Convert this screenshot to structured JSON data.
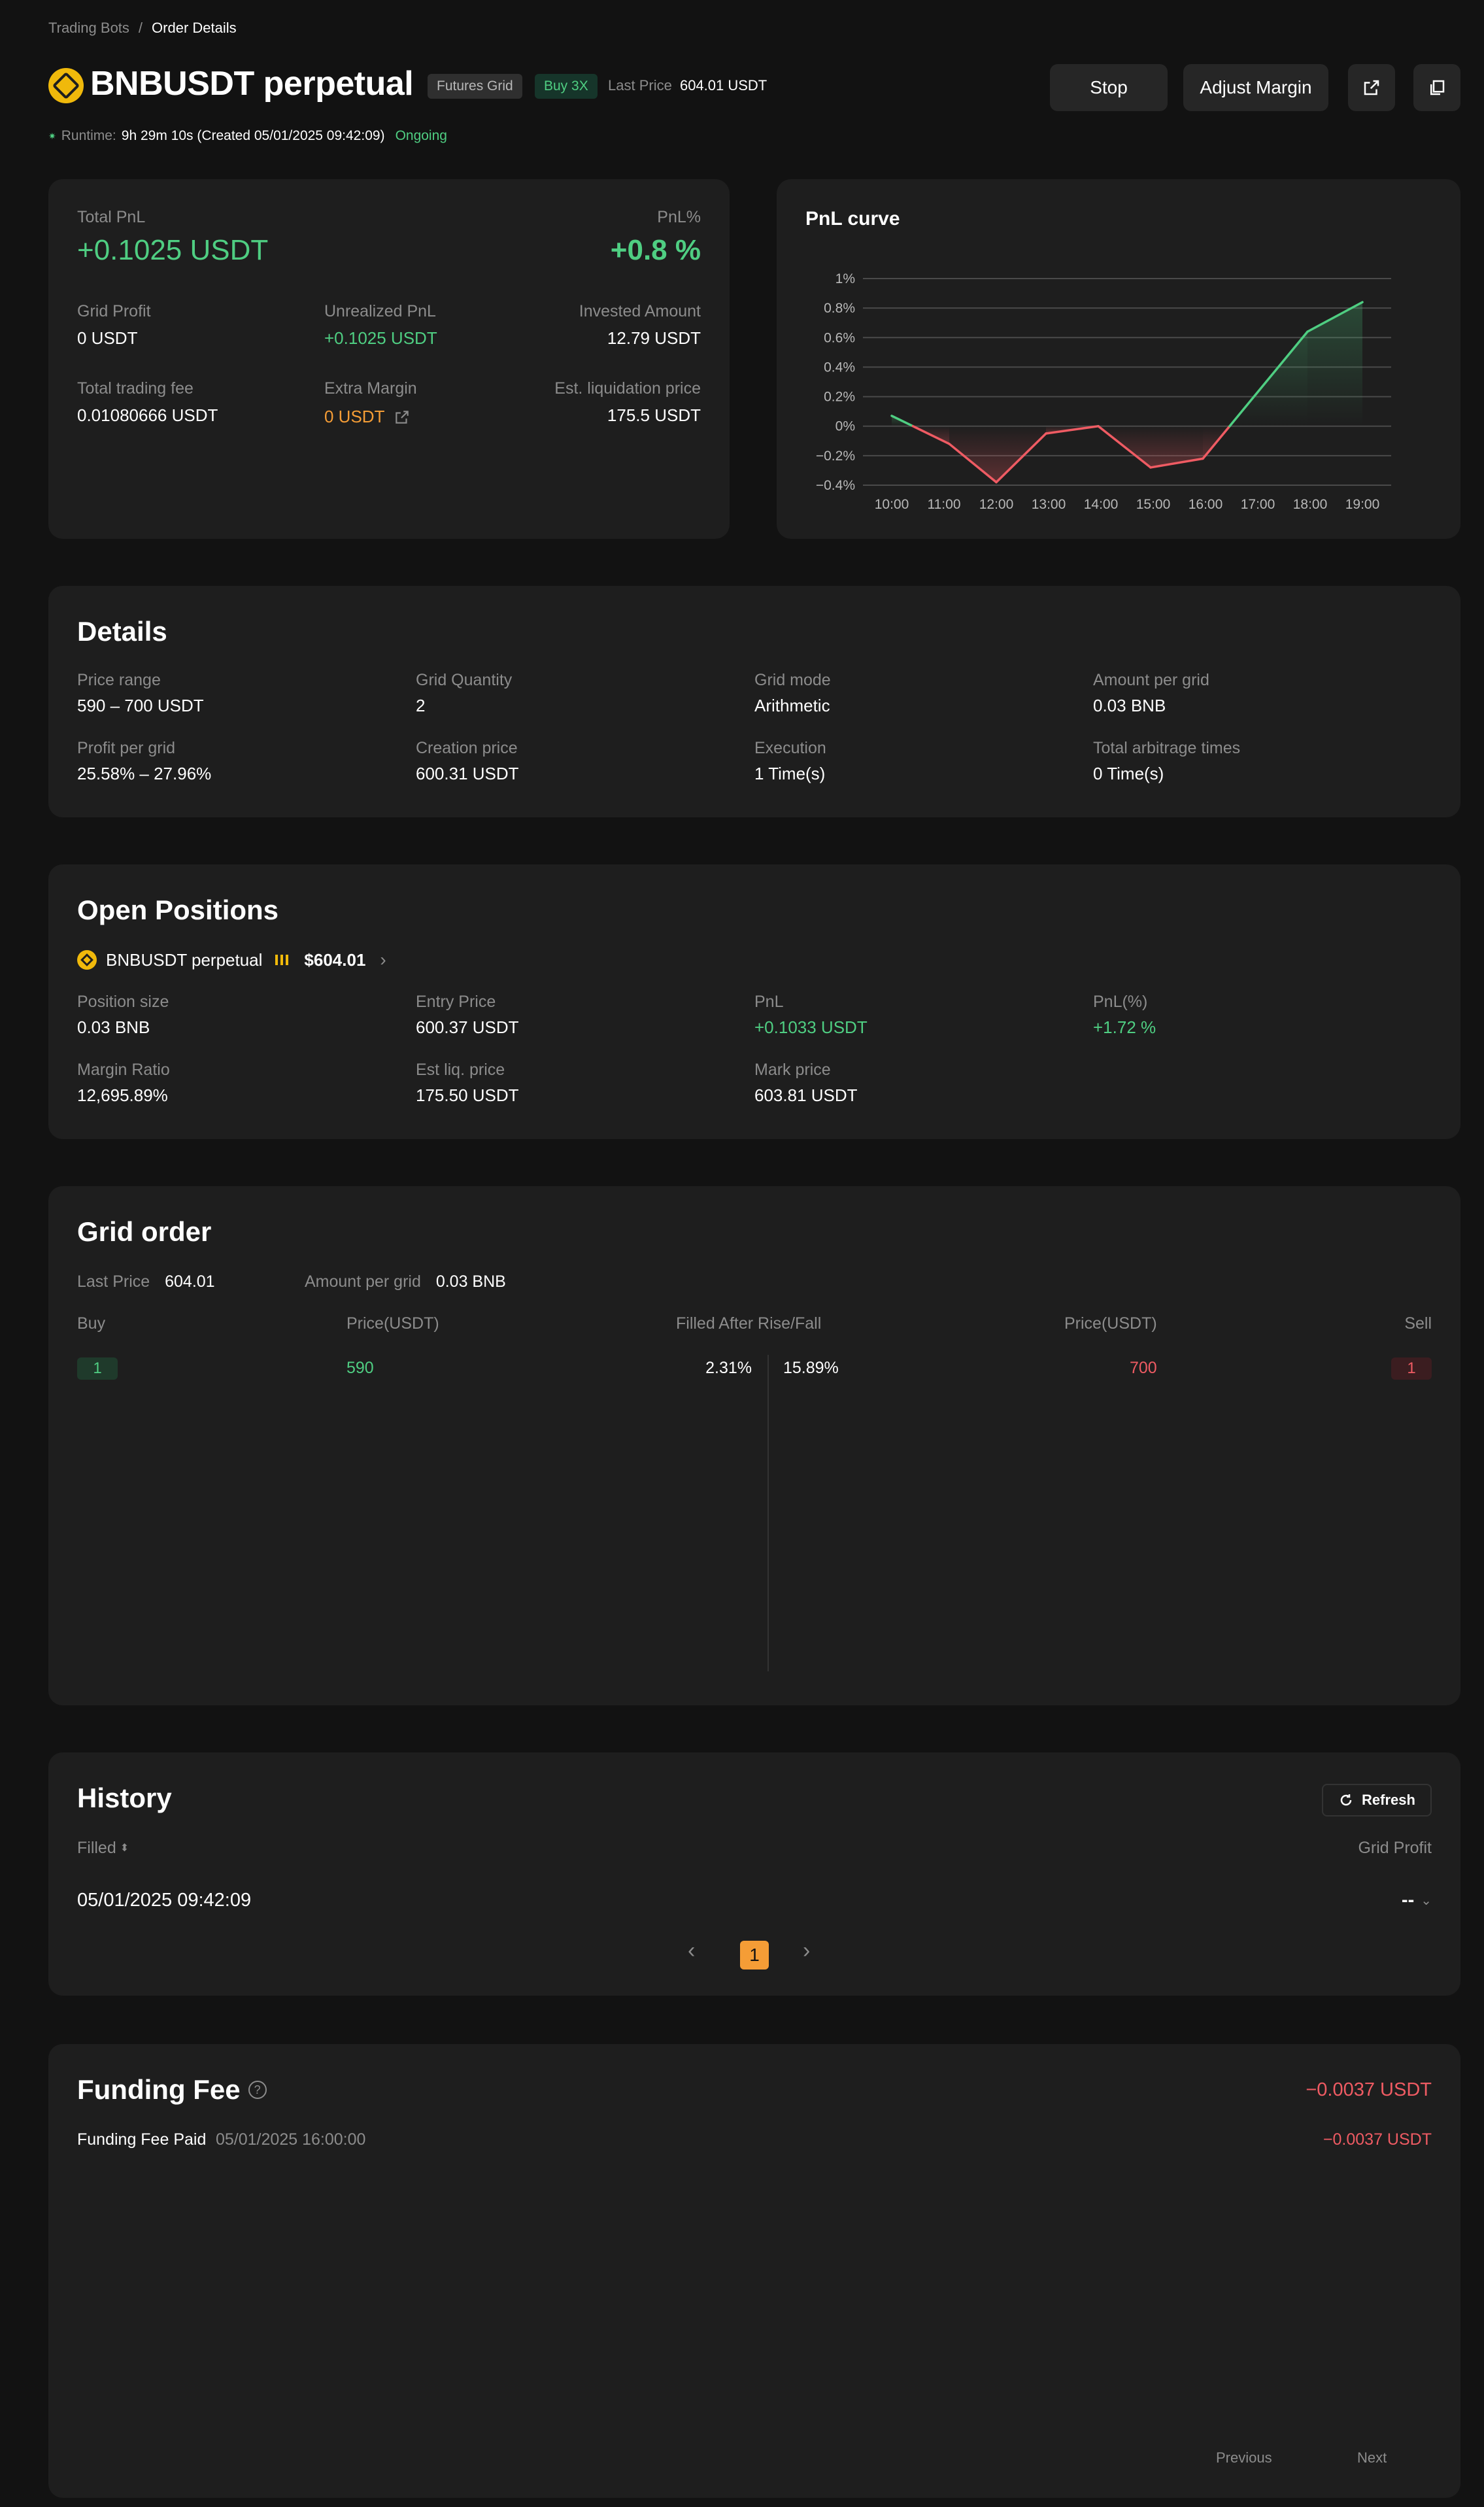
{
  "breadcrumb": {
    "root": "Trading Bots",
    "separator": "/",
    "current": "Order Details"
  },
  "header": {
    "title": "BNBUSDT perpetual",
    "tag_type": "Futures Grid",
    "tag_direction": "Buy 3X",
    "last_price_label": "Last Price",
    "last_price_value": "604.01 USDT",
    "stop_label": "Stop",
    "adjust_margin_label": "Adjust Margin",
    "runtime_label": "Runtime:",
    "runtime_value": "9h 29m 10s (Created 05/01/2025 09:42:09)",
    "status": "Ongoing"
  },
  "summary": {
    "total_pnl_label": "Total PnL",
    "total_pnl_value": "+0.1025 USDT",
    "pnl_pct_label": "PnL%",
    "pnl_pct_value": "+0.8 %",
    "grid_profit_label": "Grid Profit",
    "grid_profit_value": "0 USDT",
    "unrealized_label": "Unrealized PnL",
    "unrealized_value": "+0.1025 USDT",
    "invested_label": "Invested Amount",
    "invested_value": "12.79 USDT",
    "fee_label": "Total trading fee",
    "fee_value": "0.01080666 USDT",
    "extra_margin_label": "Extra Margin",
    "extra_margin_value": "0 USDT",
    "liq_label": "Est. liquidation price",
    "liq_value": "175.5 USDT"
  },
  "chart_data": {
    "type": "line",
    "title": "PnL curve",
    "x": [
      "10:00",
      "11:00",
      "12:00",
      "13:00",
      "14:00",
      "15:00",
      "16:00",
      "17:00",
      "18:00",
      "19:00"
    ],
    "x_positions": [
      0,
      1,
      2,
      3,
      4,
      5,
      6,
      7,
      8,
      9
    ],
    "series": [
      {
        "points": [
          [
            0,
            0.07
          ],
          [
            1.1,
            -0.12
          ],
          [
            2,
            -0.38
          ],
          [
            2.95,
            -0.05
          ],
          [
            3.95,
            0.0
          ],
          [
            4.95,
            -0.28
          ],
          [
            5.95,
            -0.22
          ],
          [
            7.95,
            0.64
          ],
          [
            9,
            0.84
          ]
        ]
      }
    ],
    "y_ticks": [
      1,
      0.8,
      0.6,
      0.4,
      0.2,
      0,
      -0.2,
      -0.4
    ],
    "y_tick_labels": [
      "1%",
      "0.8%",
      "0.6%",
      "0.4%",
      "0.2%",
      "0%",
      "−0.2%",
      "−0.4%"
    ],
    "ylim": [
      -0.4,
      1
    ],
    "grid": true,
    "colors": {
      "positive": "#4fce82",
      "negative": "#ef5b63"
    }
  },
  "details": {
    "title": "Details",
    "items": [
      {
        "label": "Price range",
        "value": "590 – 700 USDT"
      },
      {
        "label": "Grid Quantity",
        "value": "2"
      },
      {
        "label": "Grid mode",
        "value": "Arithmetic"
      },
      {
        "label": "Amount per grid",
        "value": "0.03 BNB"
      },
      {
        "label": "Profit per grid",
        "value": "25.58% – 27.96%"
      },
      {
        "label": "Creation price",
        "value": "600.31 USDT"
      },
      {
        "label": "Execution",
        "value": "1 Time(s)"
      },
      {
        "label": "Total arbitrage times",
        "value": "0 Time(s)"
      }
    ]
  },
  "positions": {
    "title": "Open Positions",
    "symbol": "BNBUSDT perpetual",
    "mark": "$604.01",
    "items": [
      {
        "label": "Position size",
        "value": "0.03 BNB"
      },
      {
        "label": "Entry Price",
        "value": "600.37 USDT"
      },
      {
        "label": "PnL",
        "value": "+0.1033 USDT"
      },
      {
        "label": "PnL(%)",
        "value": "+1.72 %"
      },
      {
        "label": "Margin Ratio",
        "value": "12,695.89%"
      },
      {
        "label": "Est liq. price",
        "value": "175.50 USDT"
      },
      {
        "label": "Mark price",
        "value": "603.81 USDT"
      }
    ]
  },
  "grid_order": {
    "title": "Grid order",
    "last_price_label": "Last Price",
    "last_price_value": "604.01",
    "amount_label": "Amount per grid",
    "amount_value": "0.03 BNB",
    "col_buy": "Buy",
    "col_price_buy": "Price(USDT)",
    "col_filled": "Filled After Rise/Fall",
    "col_price_sell": "Price(USDT)",
    "col_sell": "Sell",
    "row": {
      "buy_index": "1",
      "buy_price": "590",
      "buy_pct": "2.31%",
      "sell_pct": "15.89%",
      "sell_price": "700",
      "sell_index": "1"
    }
  },
  "history": {
    "title": "History",
    "refresh_label": "Refresh",
    "filled_label": "Filled",
    "grid_profit_label": "Grid Profit",
    "row_date": "05/01/2025 09:42:09",
    "row_profit": "--",
    "page": "1"
  },
  "funding": {
    "title": "Funding Fee",
    "total": "−0.0037 USDT",
    "row_label": "Funding Fee Paid",
    "row_date": "05/01/2025 16:00:00",
    "row_value": "−0.0037 USDT",
    "prev_label": "Previous",
    "next_label": "Next"
  }
}
